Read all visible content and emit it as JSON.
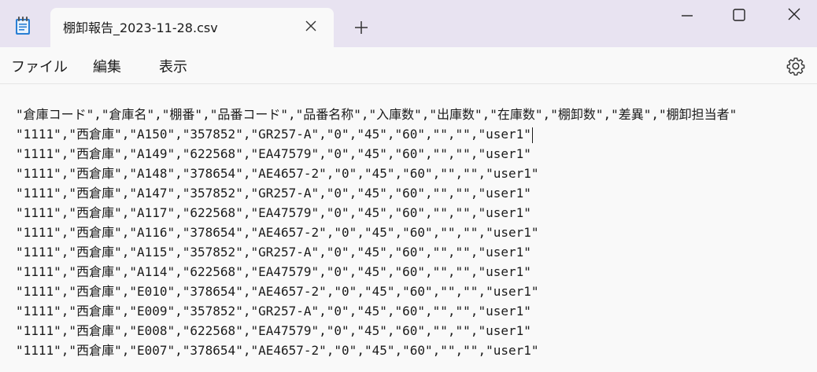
{
  "window": {
    "tab_title": "棚卸報告_2023-11-28.csv",
    "icons": {
      "app": "notepad-icon",
      "tab_close": "close-icon",
      "new_tab": "plus-icon",
      "minimize": "minimize-icon",
      "maximize": "maximize-icon",
      "close": "close-icon",
      "settings": "gear-icon"
    }
  },
  "menu": {
    "file": "ファイル",
    "edit": "編集",
    "view": "表示"
  },
  "editor": {
    "lines": [
      "\"倉庫コード\",\"倉庫名\",\"棚番\",\"品番コード\",\"品番名称\",\"入庫数\",\"出庫数\",\"在庫数\",\"棚卸数\",\"差異\",\"棚卸担当者\"",
      "\"1111\",\"西倉庫\",\"A150\",\"357852\",\"GR257-A\",\"0\",\"45\",\"60\",\"\",\"\",\"user1\"",
      "\"1111\",\"西倉庫\",\"A149\",\"622568\",\"EA47579\",\"0\",\"45\",\"60\",\"\",\"\",\"user1\"",
      "\"1111\",\"西倉庫\",\"A148\",\"378654\",\"AE4657-2\",\"0\",\"45\",\"60\",\"\",\"\",\"user1\"",
      "\"1111\",\"西倉庫\",\"A147\",\"357852\",\"GR257-A\",\"0\",\"45\",\"60\",\"\",\"\",\"user1\"",
      "\"1111\",\"西倉庫\",\"A117\",\"622568\",\"EA47579\",\"0\",\"45\",\"60\",\"\",\"\",\"user1\"",
      "\"1111\",\"西倉庫\",\"A116\",\"378654\",\"AE4657-2\",\"0\",\"45\",\"60\",\"\",\"\",\"user1\"",
      "\"1111\",\"西倉庫\",\"A115\",\"357852\",\"GR257-A\",\"0\",\"45\",\"60\",\"\",\"\",\"user1\"",
      "\"1111\",\"西倉庫\",\"A114\",\"622568\",\"EA47579\",\"0\",\"45\",\"60\",\"\",\"\",\"user1\"",
      "\"1111\",\"西倉庫\",\"E010\",\"378654\",\"AE4657-2\",\"0\",\"45\",\"60\",\"\",\"\",\"user1\"",
      "\"1111\",\"西倉庫\",\"E009\",\"357852\",\"GR257-A\",\"0\",\"45\",\"60\",\"\",\"\",\"user1\"",
      "\"1111\",\"西倉庫\",\"E008\",\"622568\",\"EA47579\",\"0\",\"45\",\"60\",\"\",\"\",\"user1\"",
      "\"1111\",\"西倉庫\",\"E007\",\"378654\",\"AE4657-2\",\"0\",\"45\",\"60\",\"\",\"\",\"user1\""
    ]
  }
}
